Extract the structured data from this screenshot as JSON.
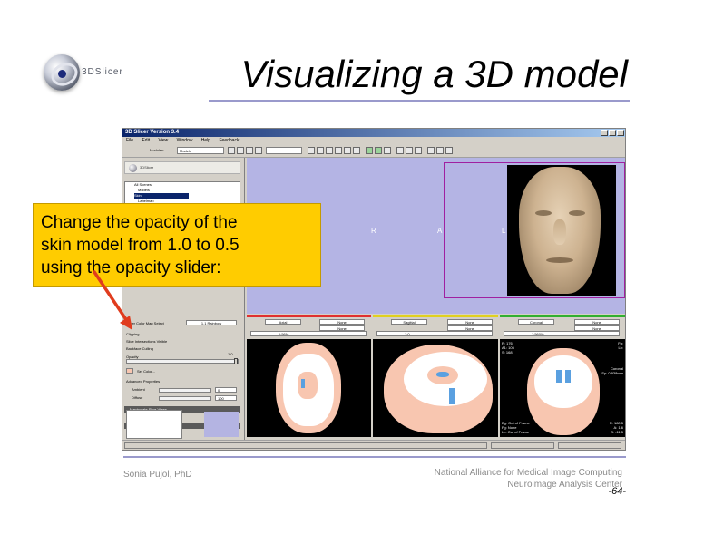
{
  "slide": {
    "logo_text": "3DSlicer",
    "title": "Visualizing a 3D model",
    "callout_line1": "Change the opacity of the",
    "callout_line2": "skin model from 1.0 to 0.5",
    "callout_line3": "using the opacity slider:",
    "author": "Sonia Pujol, PhD",
    "affiliation1": "National Alliance for Medical Image Computing",
    "affiliation2": "Neuroimage Analysis Center",
    "page_number": "-64-"
  },
  "app": {
    "title": "3D Slicer Version 3.4",
    "menu": [
      "File",
      "Edit",
      "View",
      "Window",
      "Help",
      "Feedback"
    ],
    "toolbar": {
      "modules_label": "Modules:",
      "module_value": "Models"
    },
    "panel": {
      "logo_text": "3DSlicer",
      "tree_items": [
        "All Scenes",
        "Models",
        "Skin",
        "Labelmap"
      ],
      "selected_item": "Skin",
      "slice_color_label": "Slicer Color Map Select",
      "color_value": "1.1 Rainbow",
      "clipping_label": "Clipping",
      "slice_visible_label": "Slice Intersections Visible",
      "backface_label": "Backface Culling",
      "opacity_label": "Opacity",
      "opacity_value": "1.0",
      "opacity_fraction": 1.0,
      "set_color_label": "Set Color...",
      "advanced_label": "Advanced Properties",
      "ambient_label": "Ambient",
      "ambient_value": "0",
      "diffuse_label": "Diffuse",
      "diffuse_value": "100",
      "slice_views_section": "Manipulate Slice Views",
      "view3d_section": "Manipulate 3D View"
    },
    "view3d": {
      "orient_left": "R",
      "orient_center": "A",
      "orient_right": "L",
      "background": "#b4b4e4",
      "bbox_color": "#a020a0"
    },
    "slice_controllers": [
      {
        "color": "#e03030",
        "view": "Axial",
        "layer": "None",
        "label": "None",
        "offset": "1:56%"
      },
      {
        "color": "#e0d020",
        "view": "Sagittal",
        "layer": "None",
        "label": "None",
        "offset": "1:0"
      },
      {
        "color": "#30b030",
        "view": "Coronal",
        "layer": "None",
        "label": "None",
        "offset": "1:560%"
      }
    ],
    "slice_overlays": {
      "coronal_top": [
        "R: 176",
        "A1: 105",
        "S: 168"
      ],
      "coronal_right": [
        "Coronal",
        "Sp: 0.938mm"
      ],
      "coronal_bottom": [
        "Bg: Out of Frame",
        "Fg: None",
        "Lb: Out of Frame"
      ],
      "coronal_bottom_right": [
        "R: 180.5",
        "A: 1.6",
        "S: -11.5"
      ],
      "coronal_top_right": [
        "Fg:",
        "Lb:"
      ]
    }
  },
  "colors": {
    "callout": "#ffcc00",
    "rule": "#9a9acc",
    "arrow": "#e03c1e",
    "skin": "#f8c6b0",
    "brain_white": "#ffffff",
    "ventricle": "#5aa0e0"
  }
}
